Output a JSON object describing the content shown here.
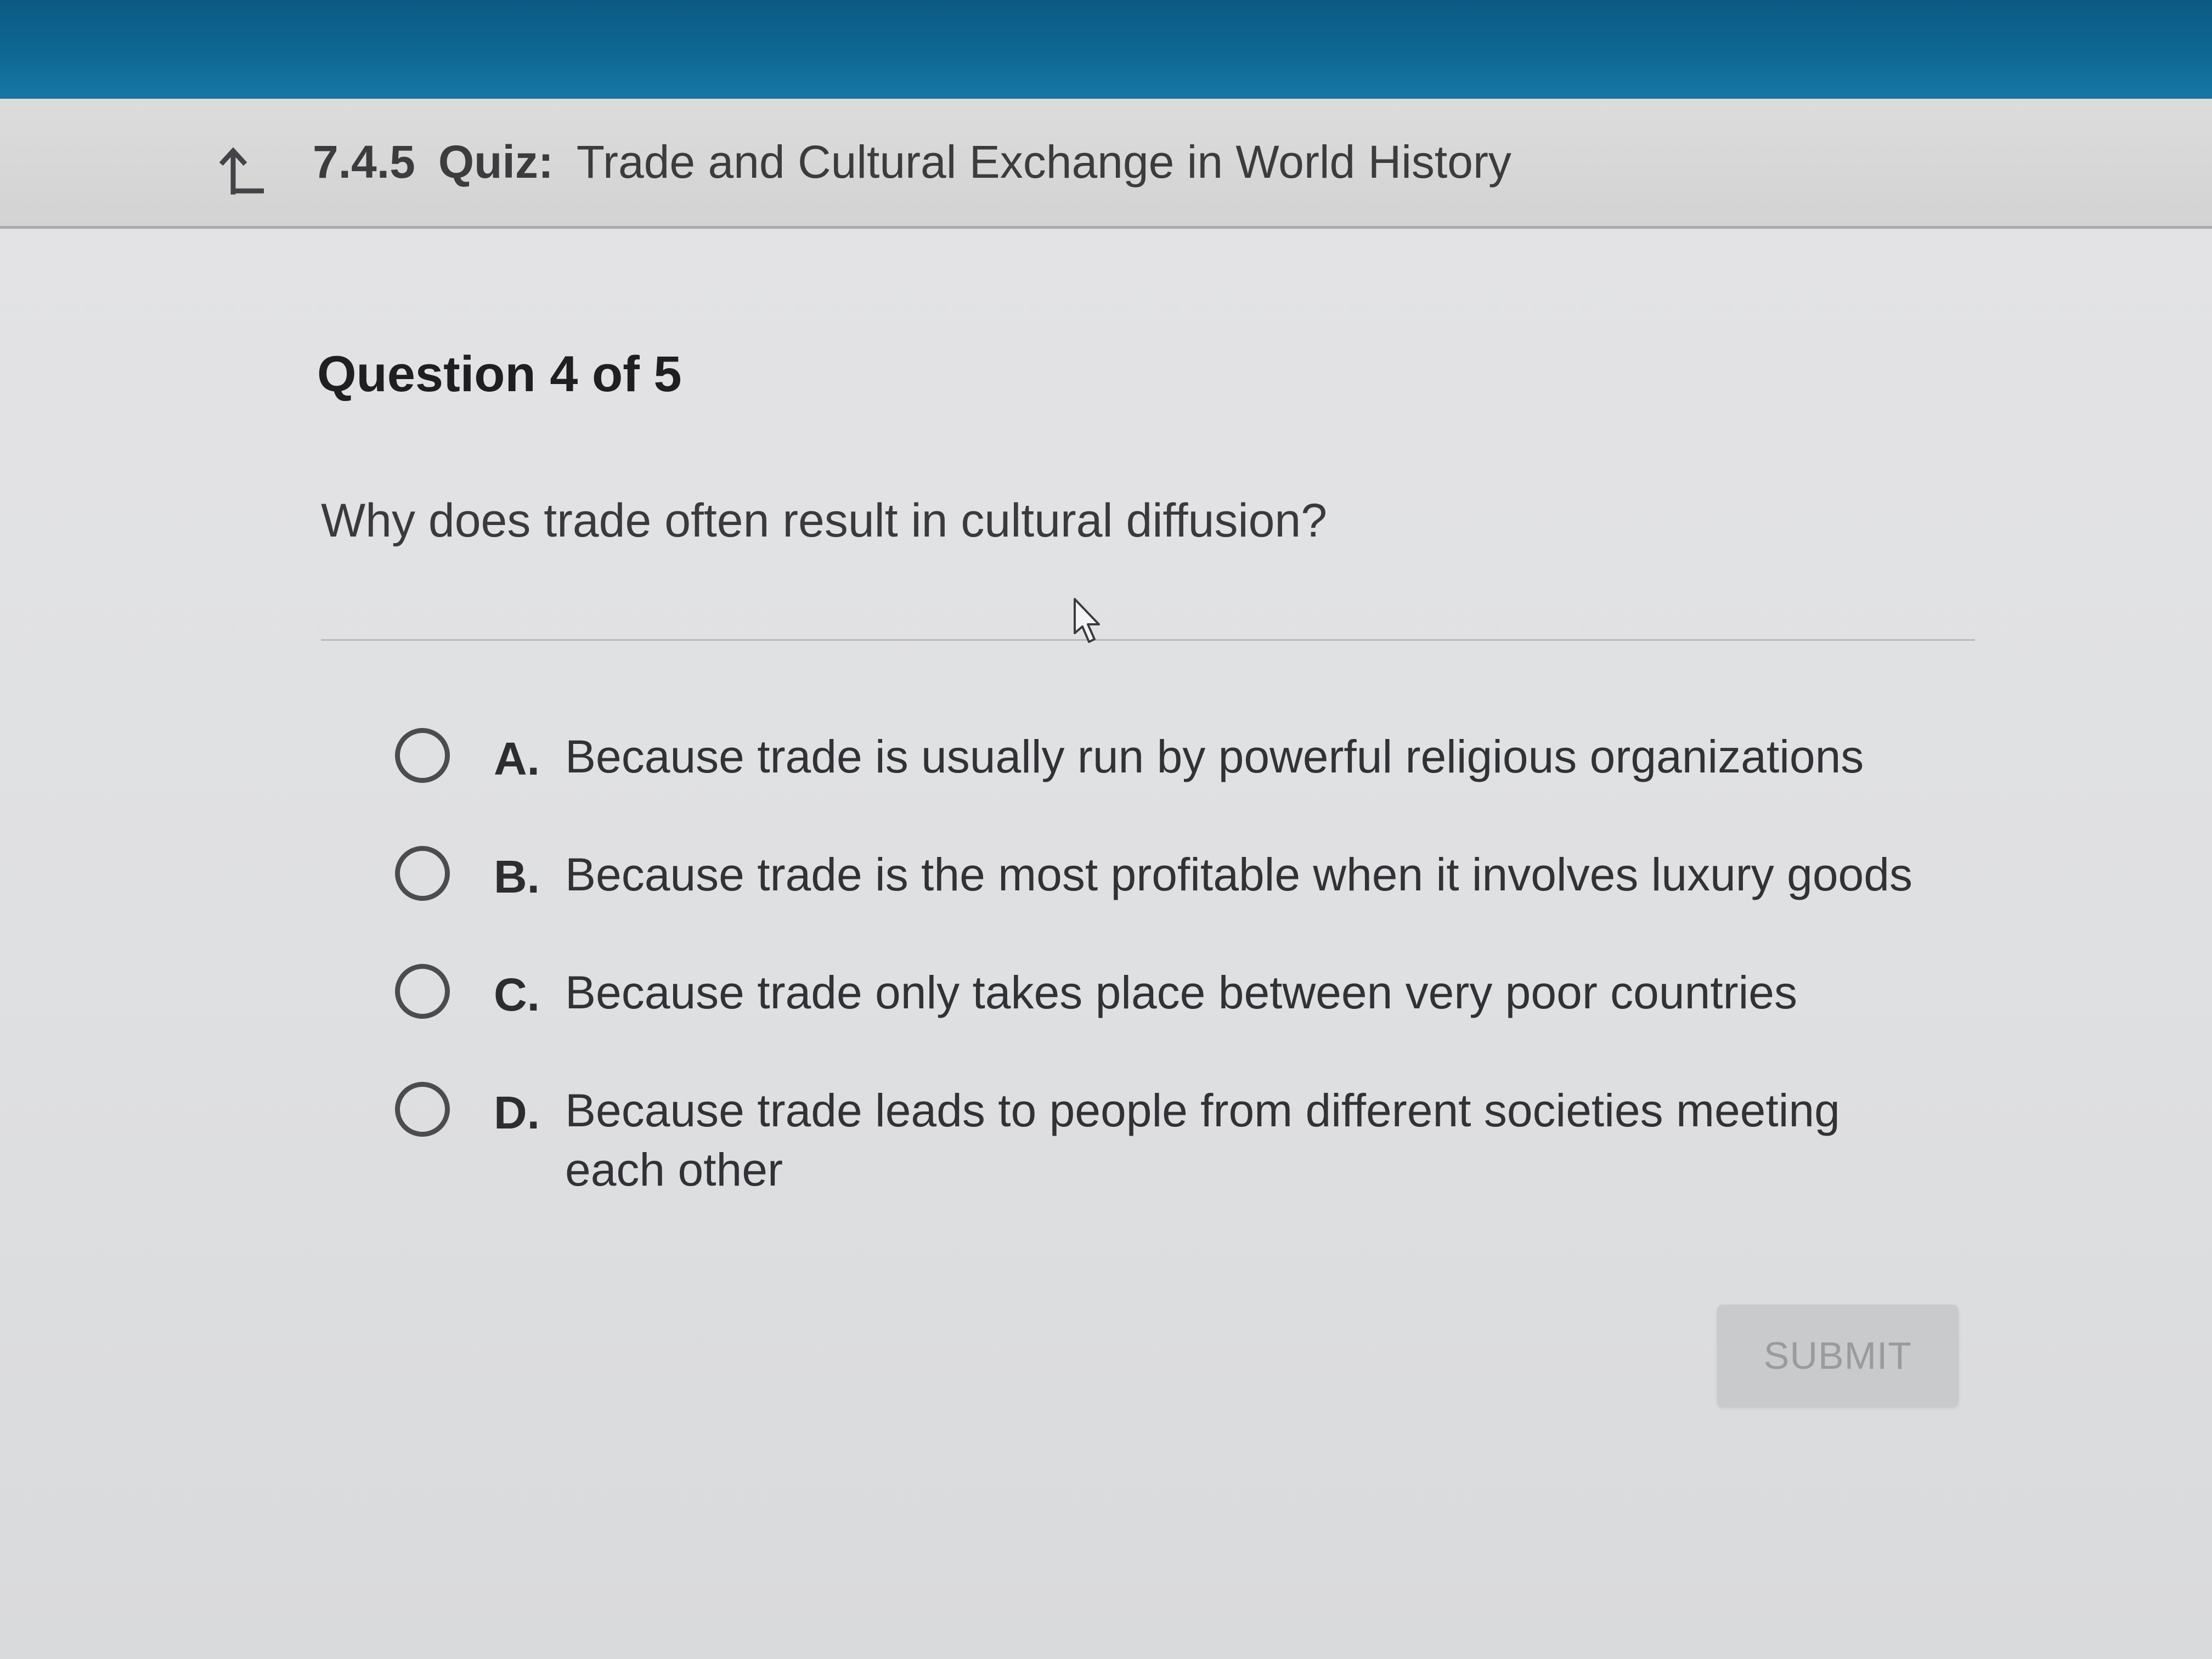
{
  "header": {
    "lesson_number": "7.4.5",
    "type_label": "Quiz:",
    "title": "Trade and Cultural Exchange in World History",
    "back_icon": "back-arrow-icon"
  },
  "question": {
    "counter": "Question 4 of 5",
    "prompt": "Why does trade often result in cultural diffusion?"
  },
  "options": [
    {
      "letter": "A.",
      "text": "Because trade is usually run by powerful religious organizations",
      "selected": false
    },
    {
      "letter": "B.",
      "text": "Because trade is the most profitable when it involves luxury goods",
      "selected": false
    },
    {
      "letter": "C.",
      "text": "Because trade only takes place between very poor countries",
      "selected": false
    },
    {
      "letter": "D.",
      "text": "Because trade leads to people from different societies meeting each other",
      "selected": false
    }
  ],
  "submit": {
    "label": "SUBMIT",
    "enabled": false
  },
  "colors": {
    "top_band": "#0f6a96",
    "header_bg": "#d6d6d7",
    "content_bg": "#e0e1e3",
    "submit_disabled_bg": "#c9cacc"
  }
}
